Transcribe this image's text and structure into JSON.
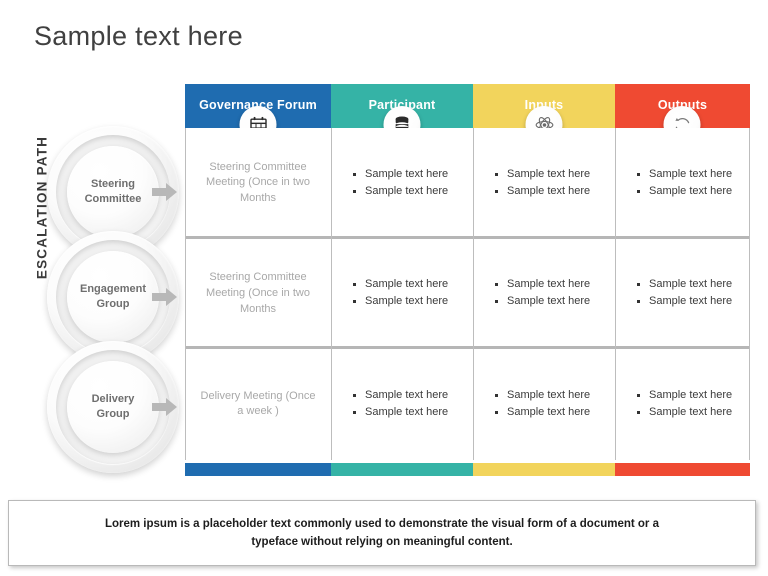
{
  "slide": {
    "title": "Sample text here",
    "escalation_label": "ESCALATION  PATH"
  },
  "colors": {
    "blue": "#1f6cb0",
    "teal": "#35b3a6",
    "yellow": "#f2d45c",
    "red": "#ef4a32",
    "divider": "#bdbdbd",
    "muted_text": "#a8a8a8",
    "body_text": "#3b3b3b",
    "title_text": "#404040"
  },
  "stages": [
    {
      "label_line1": "Steering",
      "label_line2": "Committee",
      "arrow_icon": "arrow-right-icon"
    },
    {
      "label_line1": "Engagement",
      "label_line2": "Group",
      "arrow_icon": "arrow-right-icon"
    },
    {
      "label_line1": "Delivery",
      "label_line2": "Group",
      "arrow_icon": "arrow-right-icon"
    }
  ],
  "table": {
    "columns": [
      {
        "header": "Governance Forum",
        "color": "#1f6cb0",
        "icon": "calendar-icon"
      },
      {
        "header": "Participant",
        "color": "#35b3a6",
        "icon": "database-icon"
      },
      {
        "header": "Inputs",
        "color": "#f2d45c",
        "icon": "atom-icon"
      },
      {
        "header": "Outputs",
        "color": "#ef4a32",
        "icon": "refresh-cycle-icon"
      }
    ],
    "rows": [
      {
        "meeting": "Steering Committee Meeting (Once in two Months",
        "participant": [
          "Sample text here",
          "Sample text here"
        ],
        "inputs": [
          "Sample text here",
          "Sample text here"
        ],
        "outputs": [
          "Sample text here",
          "Sample text here"
        ]
      },
      {
        "meeting": "Steering Committee Meeting (Once in two Months",
        "participant": [
          "Sample text here",
          "Sample text here"
        ],
        "inputs": [
          "Sample text here",
          "Sample text here"
        ],
        "outputs": [
          "Sample text here",
          "Sample text here"
        ]
      },
      {
        "meeting": "Delivery Meeting (Once a week )",
        "participant": [
          "Sample text here",
          "Sample text here"
        ],
        "inputs": [
          "Sample text here",
          "Sample text here"
        ],
        "outputs": [
          "Sample text here",
          "Sample text here"
        ]
      }
    ]
  },
  "footer": {
    "text": "Lorem ipsum is a placeholder text commonly used to demonstrate the visual form of a document or a typeface without relying on meaningful content."
  }
}
